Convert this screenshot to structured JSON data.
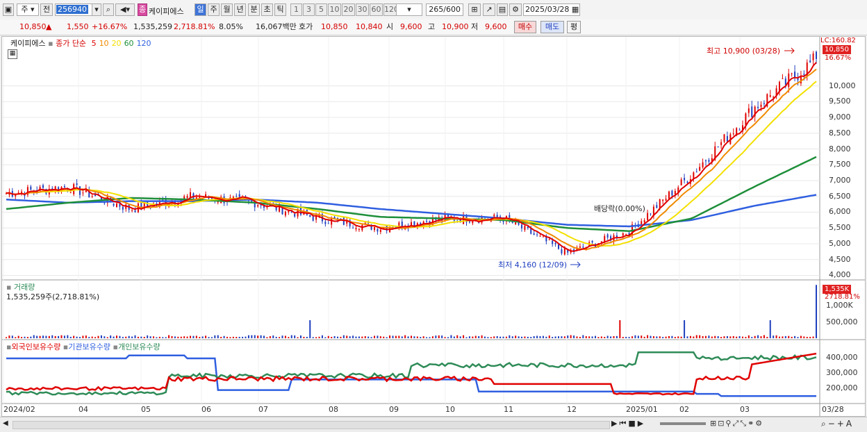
{
  "toolbar": {
    "type_label": "주",
    "prev_label": "전",
    "code_value": "256940",
    "stock_name_badge": "종",
    "stock_name": "케이피에스",
    "period_tabs": [
      "일",
      "주",
      "월",
      "년",
      "분",
      "초",
      "틱"
    ],
    "active_period": "일",
    "interval_buttons": [
      "1",
      "3",
      "5",
      "10",
      "20",
      "30",
      "60",
      "120"
    ],
    "count_value": "265",
    "count_total": "/600",
    "date_value": "2025/03/28"
  },
  "quote": {
    "price": "10,850",
    "up_mark": "▲",
    "change": "1,550",
    "change_pct": "+16.67%",
    "volume": "1,535,259",
    "volume_ratio": "2,718.81%",
    "turnover": "8.05%",
    "amount": "16,067백만",
    "hoga_label": "호가",
    "ask": "10,850",
    "bid": "10,840",
    "open_label": "시",
    "open": "9,600",
    "high_label": "고",
    "high": "10,900",
    "low_label": "저",
    "low": "9,600",
    "buy_label": "매수",
    "sell_label": "매도",
    "eval_label": "평"
  },
  "price_panel": {
    "name": "케이피에스",
    "ma_title": "종가 단순",
    "ma_periods": [
      "5",
      "10",
      "20",
      "60",
      "120"
    ],
    "ma_colors": [
      "#e00000",
      "#f08a00",
      "#f3e000",
      "#1e8f3a",
      "#2f5fe0"
    ],
    "lc_label": "LC:160.82",
    "last_price_badge": "10,850",
    "last_pct": "16.67%",
    "y_ticks": [
      "10,000",
      "9,500",
      "9,000",
      "8,500",
      "8,000",
      "7,500",
      "7,000",
      "6,500",
      "6,000",
      "5,500",
      "5,000",
      "4,500",
      "4,000"
    ],
    "high_note": "최고 10,900 (03/28)",
    "low_note": "최저 4,160 (12/09)",
    "dividend_note": "배당락(0.00%)"
  },
  "volume_panel": {
    "title": "거래량",
    "value_text": "1,535,259주(2,718.81%)",
    "badge": "1,535K",
    "badge_pct": "2718.81%",
    "y_ticks": [
      "1,000K",
      "500,000"
    ]
  },
  "holdings_panel": {
    "legend": [
      "외국인보유수량",
      "기관보유수량",
      "개인보유수량"
    ],
    "colors": [
      "#e00000",
      "#2f5fe0",
      "#2e8b57"
    ],
    "y_ticks": [
      "400,000",
      "300,000",
      "200,000"
    ]
  },
  "x_axis": [
    "2024/02",
    "04",
    "05",
    "06",
    "07",
    "08",
    "09",
    "10",
    "11",
    "12",
    "2025/01",
    "02",
    "03",
    "03/28"
  ],
  "colors": {
    "up": "#e00000",
    "down": "#1f3fbf",
    "accent": "#2f6fd0"
  },
  "chart_data": {
    "type": "candlestick",
    "x": [
      "2024/02",
      "04",
      "05",
      "06",
      "07",
      "08",
      "09",
      "10",
      "11",
      "12",
      "2025/01",
      "02",
      "03",
      "03/28"
    ],
    "close_approx": [
      6600,
      6800,
      6100,
      6500,
      6300,
      5800,
      5500,
      5800,
      5800,
      4700,
      5400,
      7200,
      9300,
      10850
    ],
    "ma120_approx": [
      6400,
      6300,
      6350,
      6350,
      6400,
      6300,
      6100,
      5950,
      5800,
      5600,
      5550,
      5750,
      6200,
      6550
    ],
    "ma60_approx": [
      6100,
      6300,
      6450,
      6400,
      6300,
      6100,
      5850,
      5800,
      5750,
      5500,
      5400,
      5800,
      6800,
      7750
    ],
    "ylim": [
      3900,
      11200
    ]
  }
}
